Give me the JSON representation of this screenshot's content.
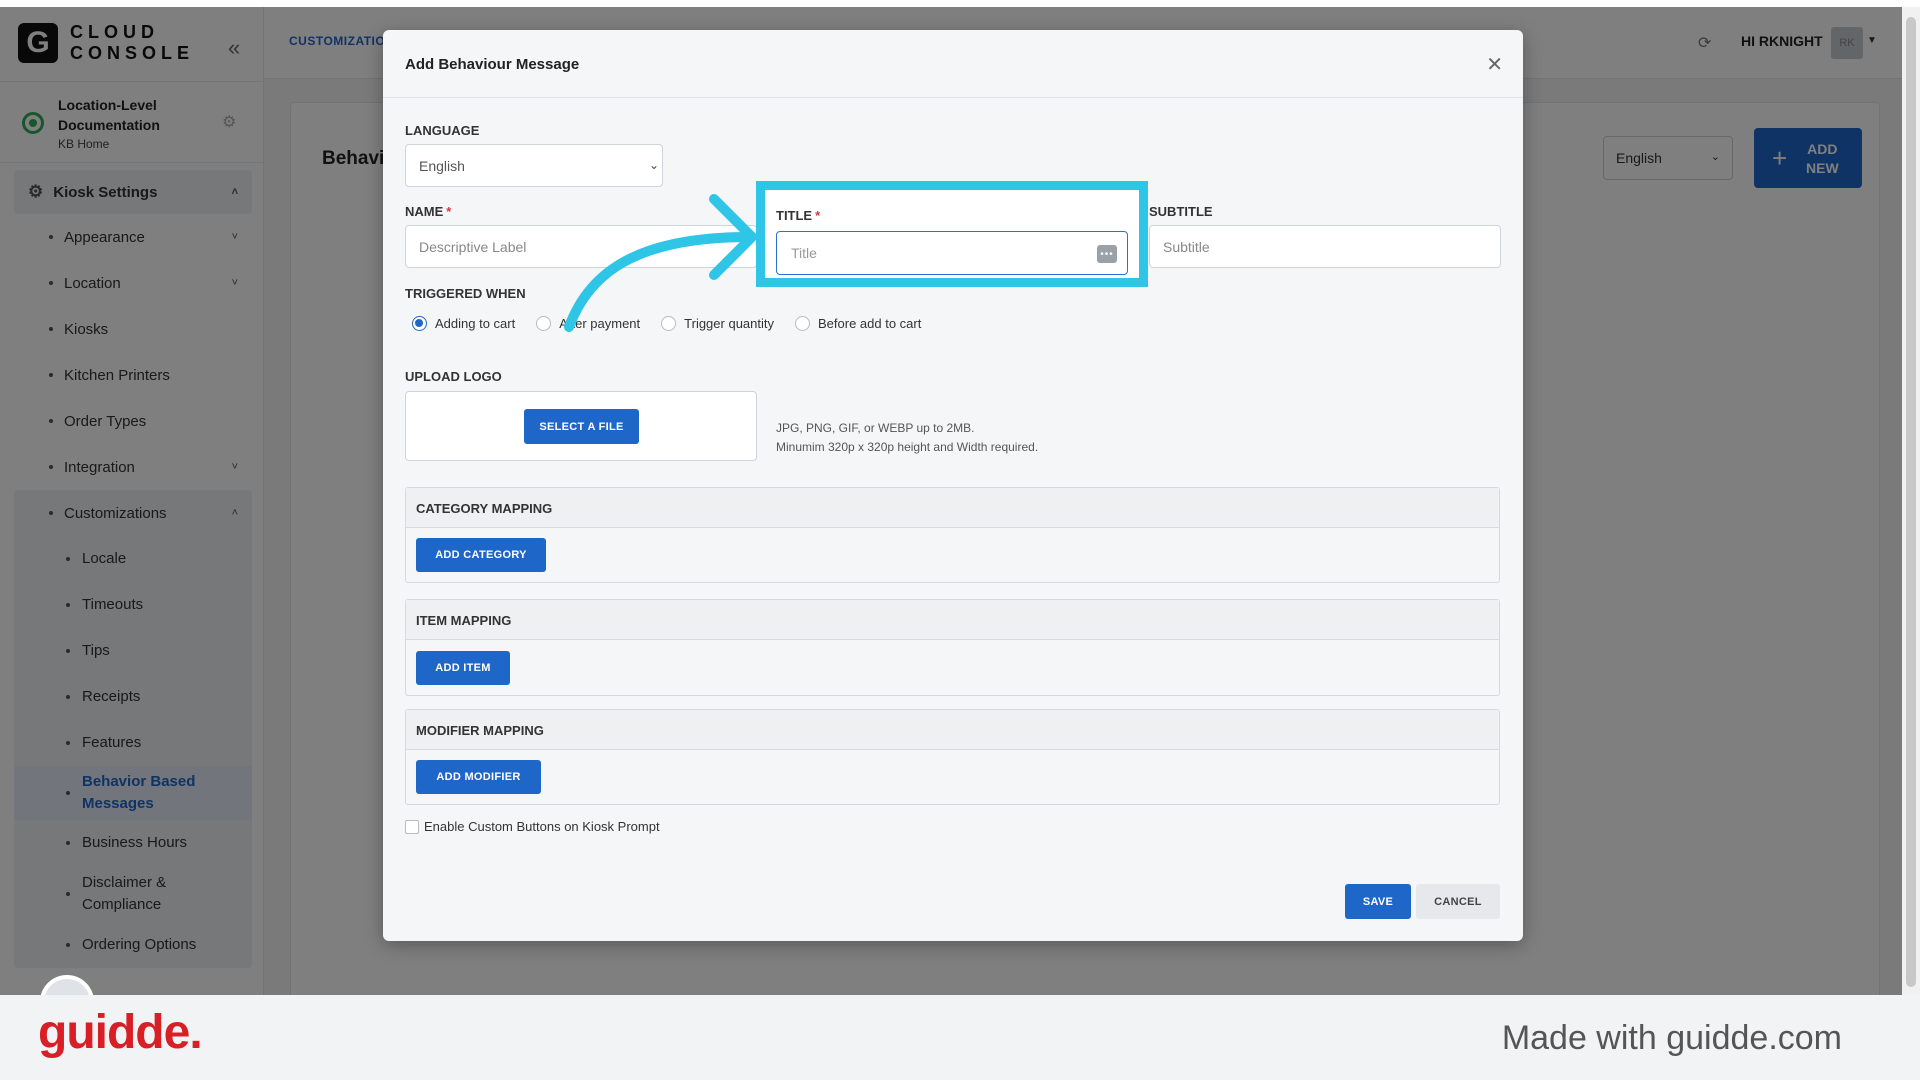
{
  "app": {
    "logo_letter": "G",
    "logo_line1": "CLOUD",
    "logo_line2": "CONSOLE",
    "location_title": "Location-Level Documentation",
    "location_sub": "KB Home",
    "breadcrumb": "CUSTOMIZATIO",
    "user_greeting": "HI RKNIGHT",
    "avatar_initials": "RK"
  },
  "sidebar": {
    "section": "Kiosk Settings",
    "items": [
      {
        "label": "Appearance",
        "chevron": "˅"
      },
      {
        "label": "Location",
        "chevron": "˅"
      },
      {
        "label": "Kiosks",
        "chevron": ""
      },
      {
        "label": "Kitchen Printers",
        "chevron": ""
      },
      {
        "label": "Order Types",
        "chevron": ""
      },
      {
        "label": "Integration",
        "chevron": "˅"
      }
    ],
    "group_label": "Customizations",
    "sub_items": [
      "Locale",
      "Timeouts",
      "Tips",
      "Receipts",
      "Features",
      "Behavior Based Messages",
      "Business Hours",
      "Disclaimer & Compliance",
      "Ordering Options"
    ]
  },
  "page": {
    "title": "Behavio",
    "language": "English",
    "add_line1": "ADD",
    "add_line2": "NEW"
  },
  "modal": {
    "title": "Add Behaviour Message",
    "language_label": "LANGUAGE",
    "language_value": "English",
    "name_label": "NAME",
    "name_placeholder": "Descriptive Label",
    "title_label": "TITLE",
    "title_placeholder": "Title",
    "subtitle_label": "SUBTITLE",
    "subtitle_placeholder": "Subtitle",
    "required_mark": "*",
    "triggered_label": "TRIGGERED WHEN",
    "triggers": [
      "Adding to cart",
      "After payment",
      "Trigger quantity",
      "Before add to cart"
    ],
    "selected_trigger": "Adding to cart",
    "upload_label": "UPLOAD LOGO",
    "select_file": "SELECT A FILE",
    "upload_hint_1": "JPG, PNG, GIF, or WEBP up to 2MB.",
    "upload_hint_2": "Minumim 320p x 320p height and Width required.",
    "category_title": "CATEGORY MAPPING",
    "add_category": "ADD CATEGORY",
    "item_title": "ITEM MAPPING",
    "add_item": "ADD ITEM",
    "modifier_title": "MODIFIER MAPPING",
    "add_modifier": "ADD MODIFIER",
    "custom_buttons_label": "Enable Custom Buttons on Kiosk Prompt",
    "save": "SAVE",
    "cancel": "CANCEL"
  },
  "footer": {
    "brand": "guidde.",
    "made_with": "Made with guidde.com"
  },
  "colors": {
    "primary": "#1f66c9",
    "highlight": "#2ec5e6",
    "brand_red": "#d81f26"
  }
}
